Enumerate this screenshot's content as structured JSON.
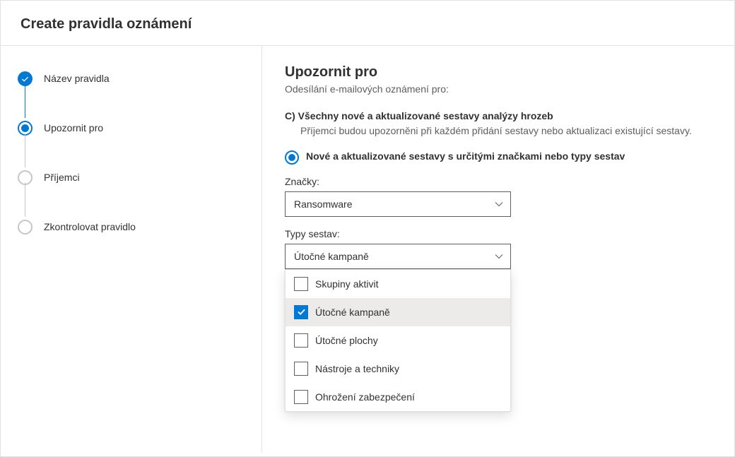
{
  "header": {
    "title": "Create pravidla oznámení"
  },
  "stepper": {
    "steps": [
      {
        "label": "Název pravidla",
        "state": "completed"
      },
      {
        "label": "Upozornit pro",
        "state": "current"
      },
      {
        "label": "Příjemci",
        "state": "pending"
      },
      {
        "label": "Zkontrolovat pravidlo",
        "state": "pending"
      }
    ]
  },
  "main": {
    "title": "Upozornit pro",
    "subtitle": "Odesílání e-mailových oznámení pro:",
    "optionC": {
      "heading": "C) Všechny nové a aktualizované sestavy analýzy hrozeb",
      "desc": "Příjemci budou upozorněni při každém přidání sestavy nebo aktualizaci existující sestavy."
    },
    "radio": {
      "label": "Nové a aktualizované sestavy s určitými značkami nebo typy sestav"
    },
    "tags": {
      "label": "Značky:",
      "value": "Ransomware"
    },
    "reportTypes": {
      "label": "Typy sestav:",
      "value": "Útočné kampaně",
      "options": [
        {
          "label": "Skupiny aktivit",
          "checked": false
        },
        {
          "label": "Útočné kampaně",
          "checked": true
        },
        {
          "label": "Útočné plochy",
          "checked": false
        },
        {
          "label": "Nástroje a techniky",
          "checked": false
        },
        {
          "label": "Ohrožení zabezpečení",
          "checked": false
        }
      ]
    }
  }
}
